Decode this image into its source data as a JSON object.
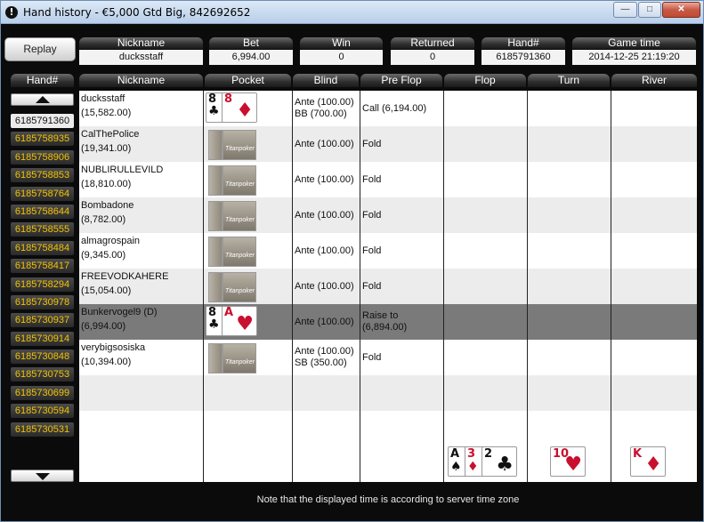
{
  "window": {
    "title": "Hand history - €5,000 Gtd Big, 842692652",
    "minimize": "—",
    "maximize": "□",
    "close": "✕"
  },
  "replay_label": "Replay",
  "summary": {
    "nickname_label": "Nickname",
    "nickname_value": "ducksstaff",
    "bet_label": "Bet",
    "bet_value": "6,994.00",
    "win_label": "Win",
    "win_value": "0",
    "returned_label": "Returned",
    "returned_value": "0",
    "hand_label": "Hand#",
    "hand_value": "6185791360",
    "time_label": "Game time",
    "time_value": "2014-12-25 21:19:20"
  },
  "hand_list": {
    "header": "Hand#",
    "items": [
      "6185791360",
      "6185758935",
      "6185758906",
      "6185758853",
      "6185758764",
      "6185758644",
      "6185758555",
      "6185758484",
      "6185758417",
      "6185758294",
      "6185730978",
      "6185730937",
      "6185730914",
      "6185730848",
      "6185730753",
      "6185730699",
      "6185730594",
      "6185730531"
    ]
  },
  "columns": [
    "Nickname",
    "Pocket",
    "Blind",
    "Pre Flop",
    "Flop",
    "Turn",
    "River"
  ],
  "players": [
    {
      "name": "ducksstaff",
      "stack": "(15,582.00)",
      "blind1": "Ante (100.00)",
      "blind2": "BB (700.00)",
      "preflop1": "Call (6,194.00)",
      "preflop2": ""
    },
    {
      "name": "CalThePolice",
      "stack": "(19,341.00)",
      "blind1": "Ante (100.00)",
      "blind2": "",
      "preflop1": "Fold",
      "preflop2": ""
    },
    {
      "name": "NUBLIRULLEVILD",
      "stack": "(18,810.00)",
      "blind1": "Ante (100.00)",
      "blind2": "",
      "preflop1": "Fold",
      "preflop2": ""
    },
    {
      "name": "Bombadone",
      "stack": "(8,782.00)",
      "blind1": "Ante (100.00)",
      "blind2": "",
      "preflop1": "Fold",
      "preflop2": ""
    },
    {
      "name": "almagrospain",
      "stack": "(9,345.00)",
      "blind1": "Ante (100.00)",
      "blind2": "",
      "preflop1": "Fold",
      "preflop2": ""
    },
    {
      "name": "FREEVODKAHERE",
      "stack": "(15,054.00)",
      "blind1": "Ante (100.00)",
      "blind2": "",
      "preflop1": "Fold",
      "preflop2": ""
    },
    {
      "name": "Bunkervogel9 (D)",
      "stack": "(6,994.00)",
      "blind1": "Ante (100.00)",
      "blind2": "",
      "preflop1": "Raise to",
      "preflop2": "(6,894.00)"
    },
    {
      "name": "verybigsosiska",
      "stack": "(10,394.00)",
      "blind1": "Ante (100.00)",
      "blind2": "SB (350.00)",
      "preflop1": "Fold",
      "preflop2": ""
    }
  ],
  "cards": {
    "hero": [
      {
        "rank": "8",
        "suit": "♣"
      },
      {
        "rank": "8",
        "suit": "♦"
      }
    ],
    "dealer": [
      {
        "rank": "8",
        "suit": "♣"
      },
      {
        "rank": "A",
        "suit": "♥"
      }
    ],
    "flop": [
      {
        "rank": "A",
        "suit": "♠"
      },
      {
        "rank": "3",
        "suit": "♦"
      },
      {
        "rank": "2",
        "suit": "♣"
      }
    ],
    "turn": {
      "rank": "10",
      "suit": "♥"
    },
    "river": {
      "rank": "K",
      "suit": "♦"
    },
    "back_logo": "Titanpoker"
  },
  "footer_note": "Note that the displayed time is according to server time zone"
}
